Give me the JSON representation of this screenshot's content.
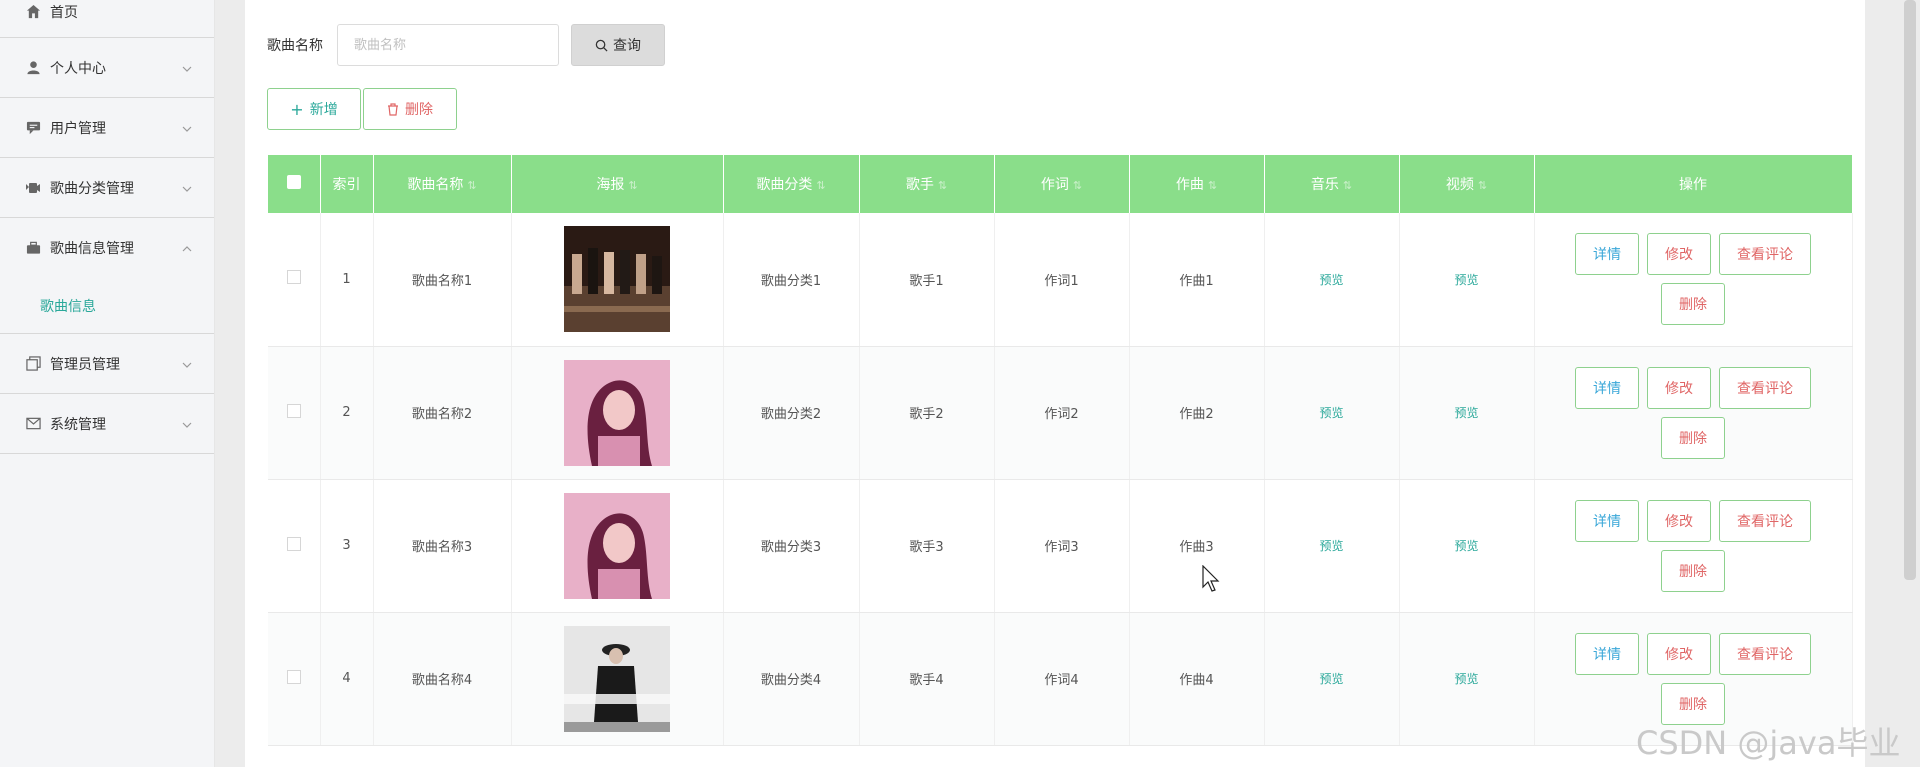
{
  "sidebar": {
    "items": [
      {
        "label": "首页",
        "icon": "home-icon"
      },
      {
        "label": "个人中心",
        "icon": "user-icon"
      },
      {
        "label": "用户管理",
        "icon": "message-icon"
      },
      {
        "label": "歌曲分类管理",
        "icon": "video-icon"
      },
      {
        "label": "歌曲信息管理",
        "icon": "briefcase-icon",
        "expanded": true,
        "sub": "歌曲信息"
      },
      {
        "label": "管理员管理",
        "icon": "copy-icon"
      },
      {
        "label": "系统管理",
        "icon": "mail-icon"
      }
    ]
  },
  "search": {
    "label": "歌曲名称",
    "placeholder": "歌曲名称",
    "button": "查询"
  },
  "actions": {
    "add": "新增",
    "delete": "删除"
  },
  "table": {
    "headers": [
      "索引",
      "歌曲名称",
      "海报",
      "歌曲分类",
      "歌手",
      "作词",
      "作曲",
      "音乐",
      "视频",
      "操作"
    ],
    "rows": [
      {
        "index": "1",
        "name": "歌曲名称1",
        "category": "歌曲分类1",
        "singer": "歌手1",
        "lyricist": "作词1",
        "composer": "作曲1",
        "music": "预览",
        "video": "预览"
      },
      {
        "index": "2",
        "name": "歌曲名称2",
        "category": "歌曲分类2",
        "singer": "歌手2",
        "lyricist": "作词2",
        "composer": "作曲2",
        "music": "预览",
        "video": "预览"
      },
      {
        "index": "3",
        "name": "歌曲名称3",
        "category": "歌曲分类3",
        "singer": "歌手3",
        "lyricist": "作词3",
        "composer": "作曲3",
        "music": "预览",
        "video": "预览"
      },
      {
        "index": "4",
        "name": "歌曲名称4",
        "category": "歌曲分类4",
        "singer": "歌手4",
        "lyricist": "作词4",
        "composer": "作曲4",
        "music": "预览",
        "video": "预览"
      }
    ],
    "ops": {
      "detail": "详情",
      "edit": "修改",
      "comments": "查看评论",
      "delete": "删除"
    }
  },
  "colors": {
    "header": "#8ade8a",
    "accent": "#2aa89a",
    "danger": "#e06666",
    "info": "#3aa7d8"
  },
  "watermark": "CSDN @java毕业"
}
